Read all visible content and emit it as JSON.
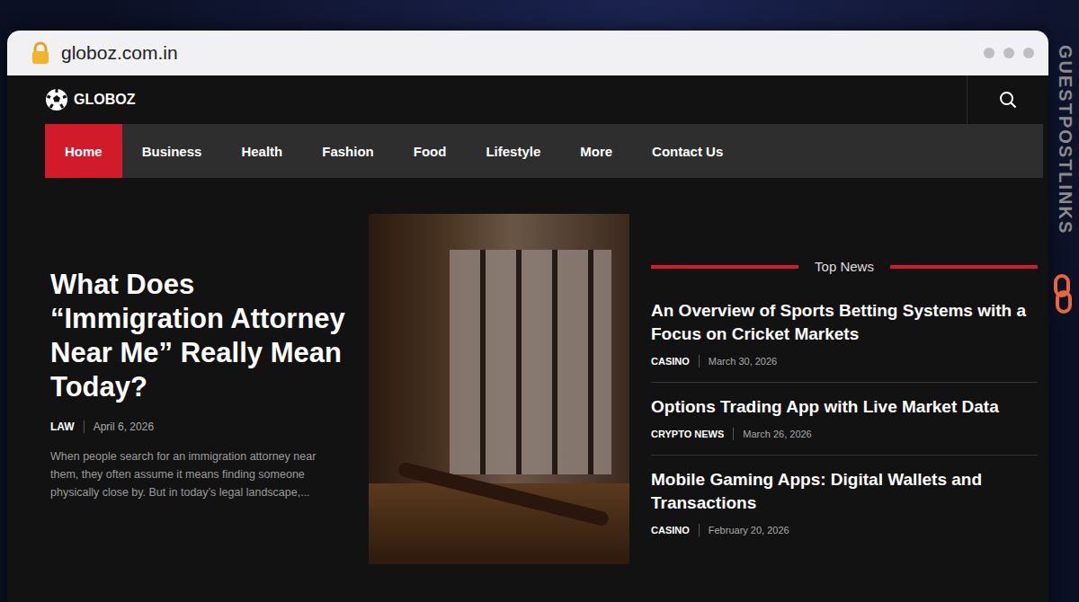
{
  "browser": {
    "url": "globoz.com.in"
  },
  "site": {
    "logo": "GLOBOZ"
  },
  "nav": [
    {
      "label": "Home",
      "selected": true
    },
    {
      "label": "Business",
      "selected": false
    },
    {
      "label": "Health",
      "selected": false
    },
    {
      "label": "Fashion",
      "selected": false
    },
    {
      "label": "Food",
      "selected": false
    },
    {
      "label": "Lifestyle",
      "selected": false
    },
    {
      "label": "More",
      "selected": false
    },
    {
      "label": "Contact Us",
      "selected": false
    }
  ],
  "hero": {
    "title": "What Does “Immigration Attorney Near Me” Really Mean Today?",
    "category": "LAW",
    "date": "April 6, 2026",
    "excerpt": "When people search for an immigration attorney near them, they often assume it means finding someone physically close by. But in today’s legal landscape,..."
  },
  "top_news": {
    "heading": "Top News",
    "items": [
      {
        "title": "An Overview of Sports Betting Systems with a Focus on Cricket Markets",
        "category": "CASINO",
        "date": "March 30, 2026"
      },
      {
        "title": "Options Trading App with Live Market Data",
        "category": "CRYPTO NEWS",
        "date": "March 26, 2026"
      },
      {
        "title": "Mobile Gaming Apps: Digital Wallets and Transactions",
        "category": "CASINO",
        "date": "February 20, 2026"
      }
    ]
  },
  "watermark": "GUESTPOSTLINKS"
}
